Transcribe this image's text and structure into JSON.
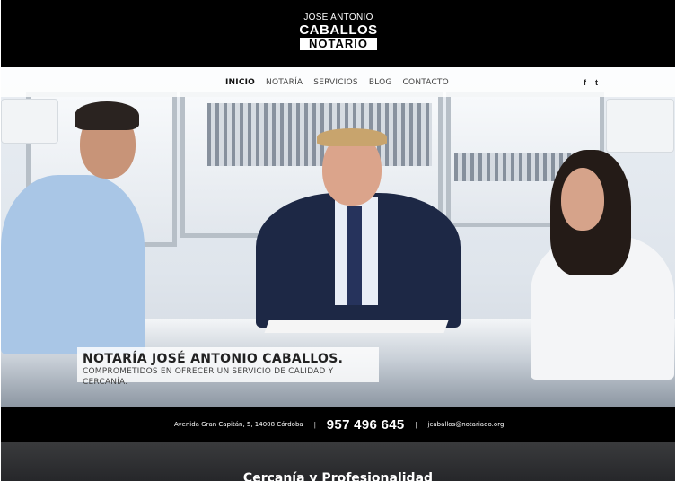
{
  "header": {
    "logo": {
      "line1": "JOSE ANTONIO",
      "line2": "CABALLOS",
      "line3": "NOTARIO"
    }
  },
  "nav": {
    "items": [
      {
        "label": "INICIO",
        "active": true
      },
      {
        "label": "NOTARÍA",
        "active": false
      },
      {
        "label": "SERVICIOS",
        "active": false
      },
      {
        "label": "BLOG",
        "active": false
      },
      {
        "label": "CONTACTO",
        "active": false
      }
    ],
    "social": [
      {
        "glyph": "f",
        "icon": "facebook-icon"
      },
      {
        "glyph": "t",
        "icon": "twitter-icon"
      }
    ]
  },
  "hero": {
    "title": "NOTARÍA JOSÉ ANTONIO CABALLOS.",
    "subtitle": "COMPROMETIDOS EN OFRECER UN SERVICIO DE CALIDAD Y CERCANÍA."
  },
  "contact": {
    "address": "Avenida Gran Capitán, 5, 14008 Córdoba",
    "separator": "|",
    "phone": "957 496 645",
    "email": "jcaballos@notariado.org"
  },
  "band": {
    "title": "Cercanía y Profesionalidad"
  },
  "colors": {
    "header_bg": "#000000",
    "contact_bg": "#000000",
    "band_bg": "#2f3033"
  }
}
